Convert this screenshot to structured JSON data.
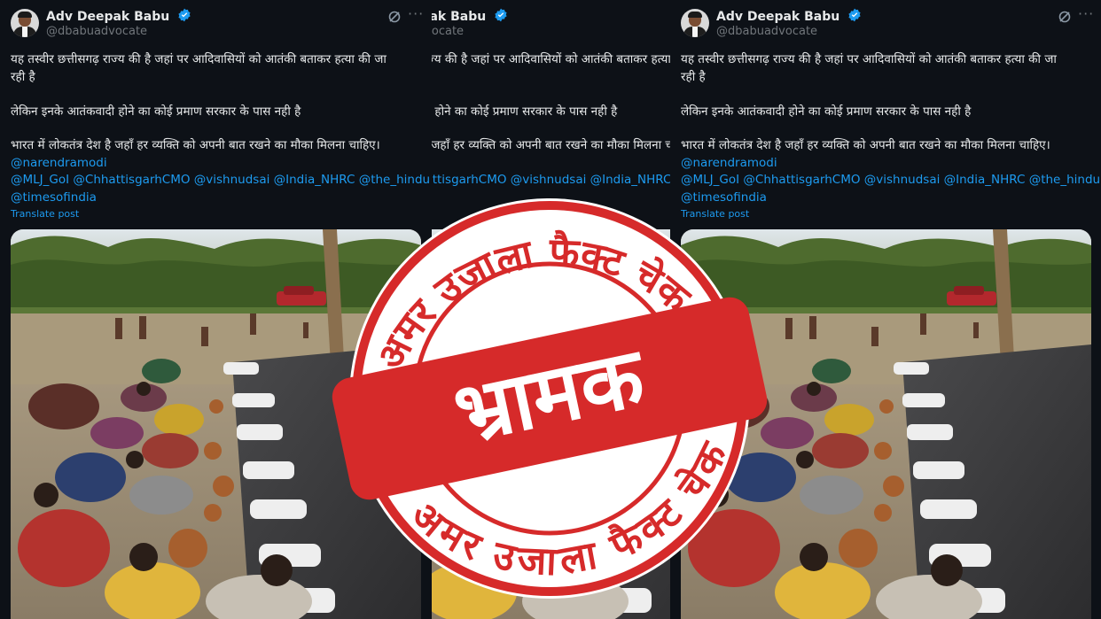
{
  "tweet": {
    "author_name": "Adv Deepak Babu",
    "handle": "@dbabuadvocate",
    "lines": [
      "यह तस्वीर छत्तीसगढ़ राज्य की है जहां पर आदिवासियों को आतंकी बताकर हत्या की जा",
      "रही है",
      "लेकिन इनके आतंकवादी होने का  कोई प्रमाण सरकार के पास नही है",
      "भारत में लोकतंत्र देश है जहाँ हर व्यक्ति को अपनी बात रखने का मौका मिलना चाहिए।"
    ],
    "mentions": [
      "@narendramodi",
      "@MLJ_GoI @ChhattisgarhCMO @vishnudsai @India_NHRC @the_hindu",
      "@timesofindia"
    ],
    "translate_label": "Translate post"
  },
  "stamp": {
    "top_text": "अमर उजाला फैक्ट चेक",
    "bottom_text": "अमर उजाला फैक्ट चेक",
    "verdict": "भ्रामक"
  },
  "colors": {
    "background": "#0d1117",
    "text": "#e7e9ea",
    "muted": "#71767b",
    "link": "#1d9bf0",
    "stamp_red": "#d62a2a"
  },
  "icons": [
    "verified-badge-icon",
    "grok-icon",
    "more-options-icon"
  ]
}
